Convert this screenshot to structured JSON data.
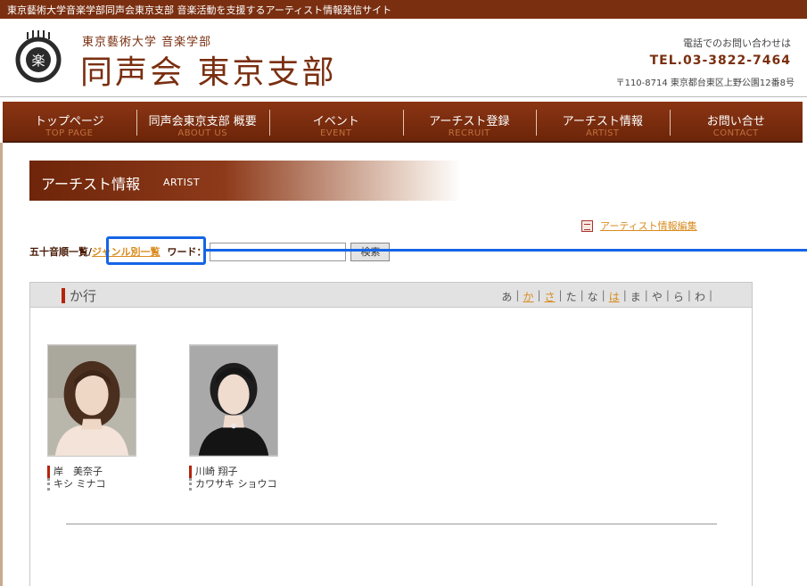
{
  "topbar": {
    "text": "東京藝術大学音楽学部同声会東京支部 音楽活動を支援するアーティスト情報発信サイト"
  },
  "header": {
    "logo_subtitle": "東京藝術大学 音楽学部",
    "logo_title": "同声会 東京支部",
    "contact_lead": "電話でのお問い合わせは",
    "tel": "TEL.03-3822-7464",
    "address": "〒110-8714 東京都台東区上野公園12番8号"
  },
  "nav": [
    {
      "ja": "トップページ",
      "en": "TOP PAGE"
    },
    {
      "ja": "同声会東京支部 概要",
      "en": "ABOUT US"
    },
    {
      "ja": "イベント",
      "en": "EVENT"
    },
    {
      "ja": "アーチスト登録",
      "en": "RECRUIT"
    },
    {
      "ja": "アーチスト情報",
      "en": "ARTIST"
    },
    {
      "ja": "お問い合せ",
      "en": "CONTACT"
    }
  ],
  "page_heading": {
    "ja": "アーチスト情報",
    "en": "ARTIST"
  },
  "edit_link": {
    "label": "アーティスト情報編集"
  },
  "search": {
    "tab_current": "五十音順一覧",
    "separator": "/",
    "tab_genre": "ジャンル別一覧",
    "label": "ワード：",
    "input_value": "",
    "button": "検索"
  },
  "results": {
    "section_title": "か行",
    "kana_nav": [
      {
        "label": "あ",
        "link": false
      },
      {
        "label": "か",
        "link": true
      },
      {
        "label": "さ",
        "link": true
      },
      {
        "label": "た",
        "link": false
      },
      {
        "label": "な",
        "link": false
      },
      {
        "label": "は",
        "link": true
      },
      {
        "label": "ま",
        "link": false
      },
      {
        "label": "や",
        "link": false
      },
      {
        "label": "ら",
        "link": false
      },
      {
        "label": "わ",
        "link": false
      }
    ],
    "artists": [
      {
        "name": "岸　美奈子",
        "kana": "キシ ミナコ"
      },
      {
        "name": "川崎 翔子",
        "kana": "カワサキ ショウコ"
      }
    ]
  },
  "colors": {
    "brand": "#7a2f10",
    "link": "#d98b1e",
    "highlight": "#1565e6"
  }
}
